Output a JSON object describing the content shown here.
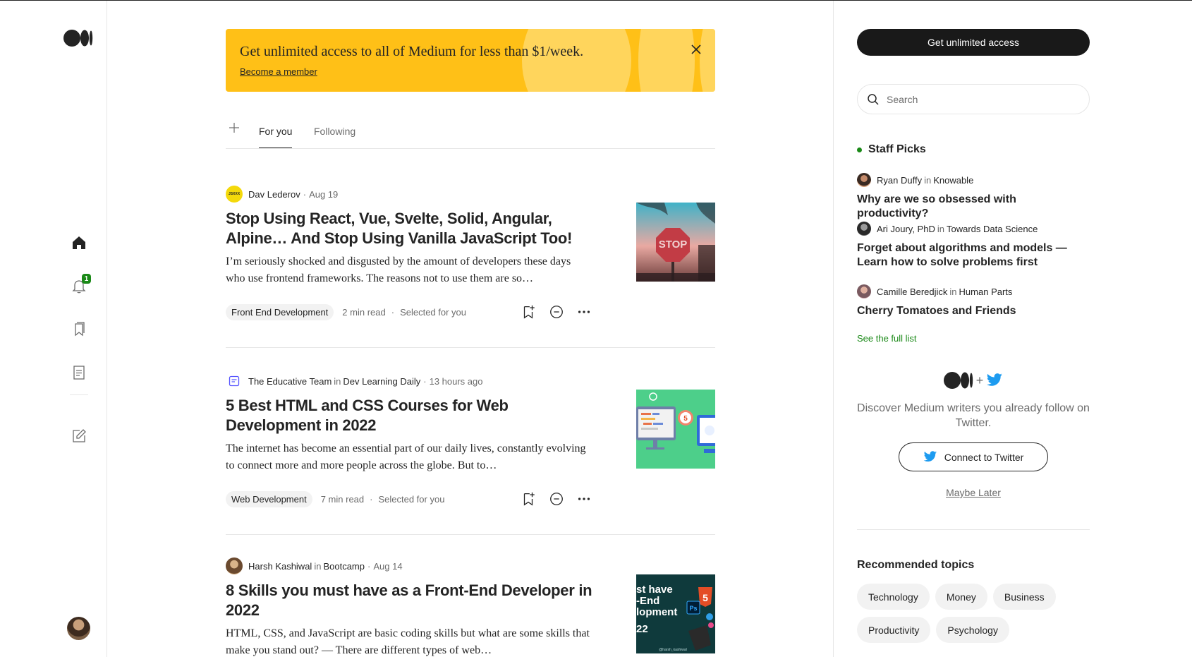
{
  "colors": {
    "accent_green": "#1a8917",
    "banner_yellow": "#ffc017",
    "twitter_blue": "#1d9bf0",
    "ink": "#242424",
    "muted": "#6b6b6b"
  },
  "left_rail": {
    "logo": "medium-logo",
    "nav": [
      "home-icon",
      "bell-icon",
      "bookmarks-icon",
      "stories-icon",
      "write-icon"
    ],
    "notification_count": "1"
  },
  "banner": {
    "text": "Get unlimited access to all of Medium for less than $1/week.",
    "link": "Become a member"
  },
  "tabs": [
    {
      "label": "For you",
      "active": true
    },
    {
      "label": "Following",
      "active": false
    }
  ],
  "articles": [
    {
      "author": "Dav Lederov",
      "avatar_text": "JSXXX",
      "publication": "",
      "date": "Aug 19",
      "title": "Stop Using React, Vue, Svelte, Solid, Angular, Alpine… And Stop Using Vanilla JavaScript Too!",
      "excerpt": "I’m seriously shocked and disgusted by the amount of developers these days who use frontend frameworks. The reasons not to use them are so…",
      "tag": "Front End Development",
      "read_time": "2 min read",
      "reason": "Selected for you"
    },
    {
      "author": "The Educative Team",
      "avatar_text": "",
      "publication": "Dev Learning Daily",
      "date": "13 hours ago",
      "title": "5 Best HTML and CSS Courses for Web Development in 2022",
      "excerpt": "The internet has become an essential part of our daily lives, constantly evolving to connect more and more people across the globe. But to…",
      "tag": "Web Development",
      "read_time": "7 min read",
      "reason": "Selected for you"
    },
    {
      "author": "Harsh Kashiwal",
      "avatar_text": "",
      "publication": "Bootcamp",
      "date": "Aug 14",
      "title": "8 Skills you must have as a Front-End Developer in 2022",
      "excerpt": "HTML, CSS, and JavaScript are basic coding skills but what are some skills that make you stand out? — There are different types of web…",
      "tag": "",
      "read_time": "",
      "reason": ""
    }
  ],
  "thumbs": {
    "stop_sign_text": "STOP",
    "html5_badge": "5",
    "ps_badge": "Ps",
    "cover_lines": [
      "st have",
      "-End",
      "lopment",
      "22"
    ],
    "credit": "@harsh_kashiwal"
  },
  "sidebar": {
    "cta": "Get unlimited access",
    "search_placeholder": "Search",
    "staff_picks_heading": "Staff Picks",
    "picks": [
      {
        "author": "Ryan Duffy",
        "publication": "Knowable",
        "title": "Why are we so obsessed with productivity?"
      },
      {
        "author": "Ari Joury, PhD",
        "publication": "Towards Data Science",
        "title": "Forget about algorithms and models — Learn how to solve problems first"
      },
      {
        "author": "Camille Beredjick",
        "publication": "Human Parts",
        "title": "Cherry Tomatoes and Friends"
      }
    ],
    "in_word": "in",
    "see_full_list": "See the full list",
    "twitter": {
      "plus": "+",
      "text": "Discover Medium writers you already follow on Twitter.",
      "button": "Connect to Twitter",
      "later": "Maybe Later"
    },
    "recommended_heading": "Recommended topics",
    "topics": [
      "Technology",
      "Money",
      "Business",
      "Productivity",
      "Psychology"
    ]
  }
}
